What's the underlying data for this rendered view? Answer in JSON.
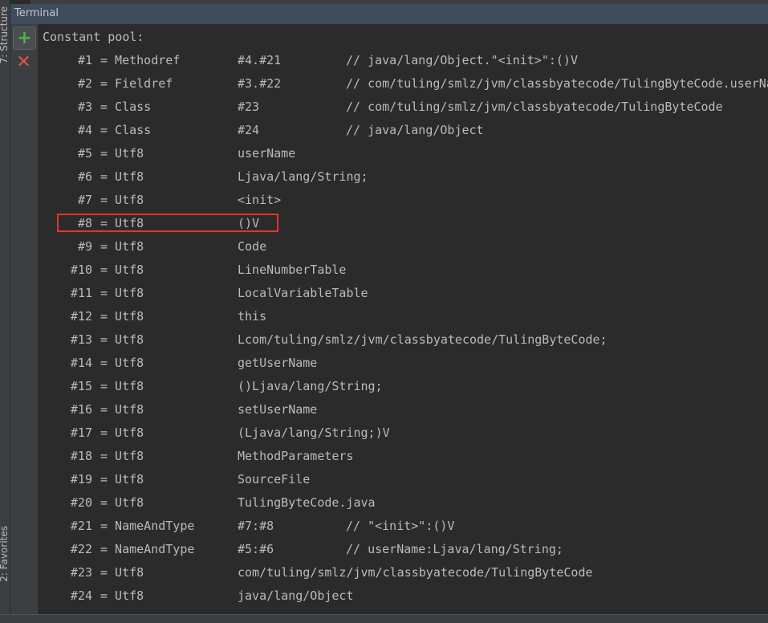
{
  "panel": {
    "title": "Terminal",
    "left_tabs": [
      "7: Structure",
      "2: Favorites"
    ]
  },
  "toolbar": {
    "new_icon": "plus-icon",
    "close_icon": "close-icon"
  },
  "console": {
    "heading": "Constant pool:",
    "highlighted_index": "#8",
    "rows": [
      {
        "index": "#1",
        "type": "= Methodref",
        "value": "#4.#21",
        "comment": "// java/lang/Object.\"<init>\":()V"
      },
      {
        "index": "#2",
        "type": "= Fieldref",
        "value": "#3.#22",
        "comment": "// com/tuling/smlz/jvm/classbyatecode/TulingByteCode.userNa"
      },
      {
        "index": "#3",
        "type": "= Class",
        "value": "#23",
        "comment": "// com/tuling/smlz/jvm/classbyatecode/TulingByteCode"
      },
      {
        "index": "#4",
        "type": "= Class",
        "value": "#24",
        "comment": "// java/lang/Object"
      },
      {
        "index": "#5",
        "type": "= Utf8",
        "value": "userName",
        "comment": ""
      },
      {
        "index": "#6",
        "type": "= Utf8",
        "value": "Ljava/lang/String;",
        "comment": ""
      },
      {
        "index": "#7",
        "type": "= Utf8",
        "value": "<init>",
        "comment": ""
      },
      {
        "index": "#8",
        "type": "= Utf8",
        "value": "()V",
        "comment": ""
      },
      {
        "index": "#9",
        "type": "= Utf8",
        "value": "Code",
        "comment": ""
      },
      {
        "index": "#10",
        "type": "= Utf8",
        "value": "LineNumberTable",
        "comment": ""
      },
      {
        "index": "#11",
        "type": "= Utf8",
        "value": "LocalVariableTable",
        "comment": ""
      },
      {
        "index": "#12",
        "type": "= Utf8",
        "value": "this",
        "comment": ""
      },
      {
        "index": "#13",
        "type": "= Utf8",
        "value": "Lcom/tuling/smlz/jvm/classbyatecode/TulingByteCode;",
        "comment": ""
      },
      {
        "index": "#14",
        "type": "= Utf8",
        "value": "getUserName",
        "comment": ""
      },
      {
        "index": "#15",
        "type": "= Utf8",
        "value": "()Ljava/lang/String;",
        "comment": ""
      },
      {
        "index": "#16",
        "type": "= Utf8",
        "value": "setUserName",
        "comment": ""
      },
      {
        "index": "#17",
        "type": "= Utf8",
        "value": "(Ljava/lang/String;)V",
        "comment": ""
      },
      {
        "index": "#18",
        "type": "= Utf8",
        "value": "MethodParameters",
        "comment": ""
      },
      {
        "index": "#19",
        "type": "= Utf8",
        "value": "SourceFile",
        "comment": ""
      },
      {
        "index": "#20",
        "type": "= Utf8",
        "value": "TulingByteCode.java",
        "comment": ""
      },
      {
        "index": "#21",
        "type": "= NameAndType",
        "value": "#7:#8",
        "comment": "// \"<init>\":()V"
      },
      {
        "index": "#22",
        "type": "= NameAndType",
        "value": "#5:#6",
        "comment": "// userName:Ljava/lang/String;"
      },
      {
        "index": "#23",
        "type": "= Utf8",
        "value": "com/tuling/smlz/jvm/classbyatecode/TulingByteCode",
        "comment": ""
      },
      {
        "index": "#24",
        "type": "= Utf8",
        "value": "java/lang/Object",
        "comment": ""
      }
    ]
  },
  "colors": {
    "background": "#2b2b2b",
    "text": "#bbbbbb",
    "highlight": "#e8322e",
    "header": "#3d4b5c"
  }
}
